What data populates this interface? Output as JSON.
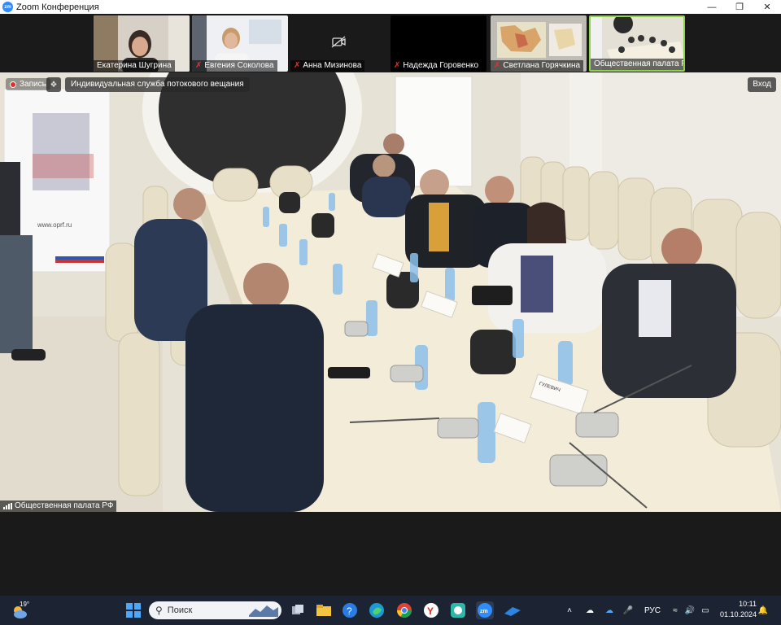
{
  "window": {
    "title": "Zoom Конференция",
    "app_icon_text": "zm"
  },
  "gallery": {
    "participants": [
      {
        "name": "Екатерина Шугрина",
        "muted": false,
        "video": true
      },
      {
        "name": "Евгения Соколова",
        "muted": true,
        "video": true
      },
      {
        "name": "Анна Мизинова",
        "muted": true,
        "video": false
      },
      {
        "name": "Надежда Горовенко",
        "muted": true,
        "video": false
      },
      {
        "name": "Светлана Горячкина",
        "muted": true,
        "video": true
      },
      {
        "name": "Общественная палата РФ",
        "muted": false,
        "video": true,
        "active": true
      }
    ]
  },
  "main_video": {
    "recording_label": "Запись",
    "stream_label": "Индивидуальная служба потокового вещания",
    "enter_label": "Вход",
    "speaker_name": "Общественная палата РФ",
    "banner_site": "www.oprf.ru",
    "nameplate_text": "ГУЛЕВИЧ"
  },
  "taskbar": {
    "weather_temp": "19°",
    "search_placeholder": "Поиск",
    "language": "РУС",
    "time": "10:11",
    "date": "01.10.2024"
  },
  "colors": {
    "zoom_blue": "#2d8cff",
    "active_speaker": "#8ed34a",
    "muted_red": "#e0342b",
    "taskbar_bg": "#1c2433"
  }
}
